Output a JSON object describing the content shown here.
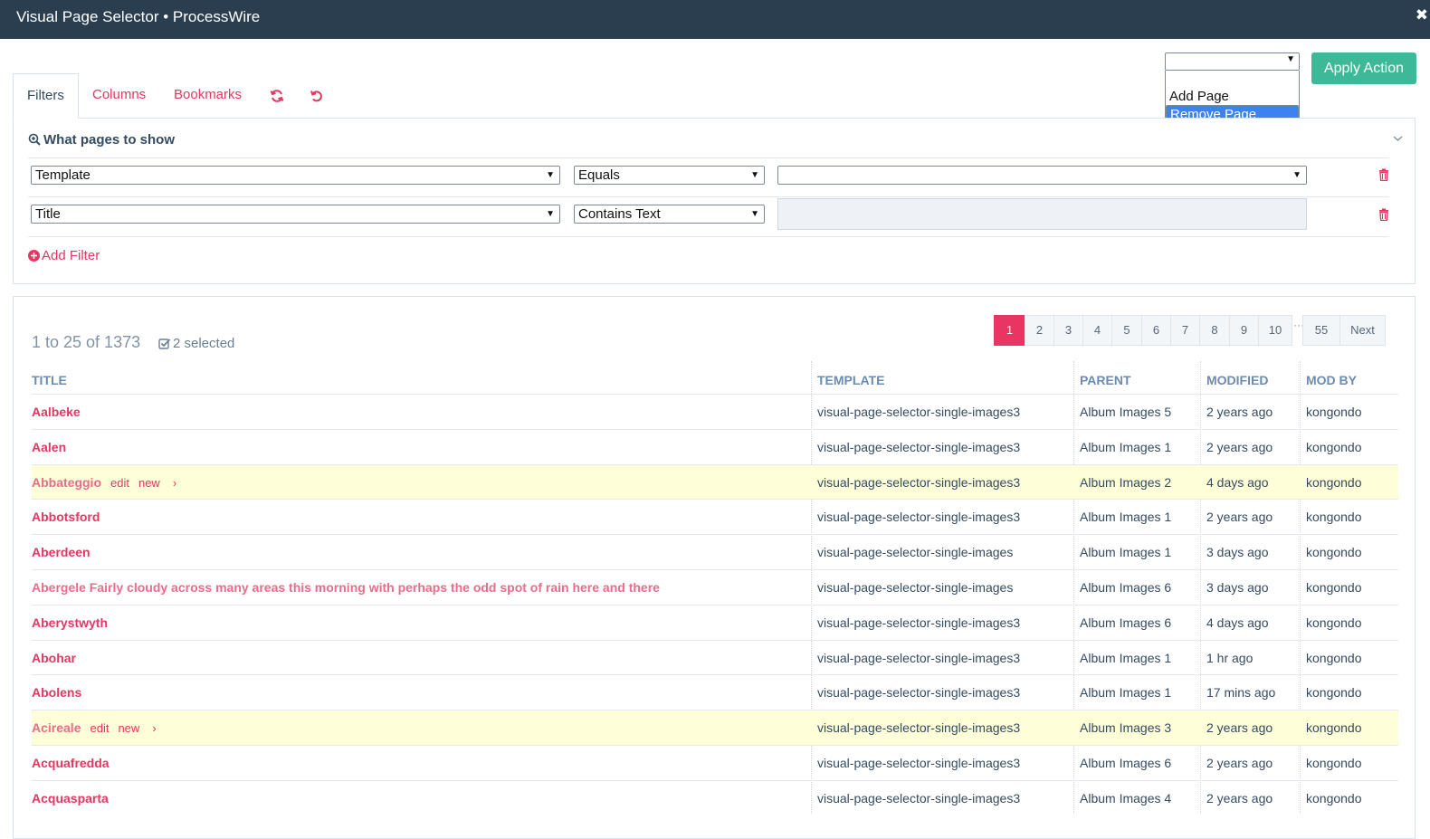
{
  "window": {
    "title": "Visual Page Selector • ProcessWire",
    "close_label": "✖"
  },
  "actions": {
    "select_value": "",
    "options": [
      "Add Page",
      "Remove Page"
    ],
    "selected_option": "Remove Page",
    "apply_label": "Apply Action"
  },
  "tabs": [
    {
      "label": "Filters",
      "active": true
    },
    {
      "label": "Columns",
      "active": false
    },
    {
      "label": "Bookmarks",
      "active": false
    }
  ],
  "tab_icons": [
    "refresh-icon",
    "reset-icon"
  ],
  "filters": {
    "heading": "What pages to show",
    "rows": [
      {
        "field": "Template",
        "operator": "Equals",
        "value": ""
      },
      {
        "field": "Title",
        "operator": "Contains Text",
        "value": ""
      }
    ],
    "add_label": "Add Filter"
  },
  "results": {
    "count": "1 to 25 of 1373",
    "selected": "2 selected",
    "pagination": [
      "1",
      "2",
      "3",
      "4",
      "5",
      "6",
      "7",
      "8",
      "9",
      "10"
    ],
    "pagination_ellipsis": "···",
    "pagination_last": "55",
    "pagination_next": "Next",
    "current_page": "1",
    "columns": [
      "TITLE",
      "TEMPLATE",
      "PARENT",
      "MODIFIED",
      "MOD BY"
    ],
    "row_actions": {
      "edit": "edit",
      "new": "new",
      "more": "›"
    },
    "rows": [
      {
        "title": "Aalbeke",
        "template": "visual-page-selector-single-images3",
        "parent": "Album Images 5",
        "modified": "2 years ago",
        "mod_by": "kongondo",
        "highlight": false
      },
      {
        "title": "Aalen",
        "template": "visual-page-selector-single-images3",
        "parent": "Album Images 1",
        "modified": "2 years ago",
        "mod_by": "kongondo",
        "highlight": false
      },
      {
        "title": "Abbateggio",
        "template": "visual-page-selector-single-images3",
        "parent": "Album Images 2",
        "modified": "4 days ago",
        "mod_by": "kongondo",
        "highlight": true
      },
      {
        "title": "Abbotsford",
        "template": "visual-page-selector-single-images3",
        "parent": "Album Images 1",
        "modified": "2 years ago",
        "mod_by": "kongondo",
        "highlight": false
      },
      {
        "title": "Aberdeen",
        "template": "visual-page-selector-single-images",
        "parent": "Album Images 1",
        "modified": "3 days ago",
        "mod_by": "kongondo",
        "highlight": false
      },
      {
        "title": "Abergele Fairly cloudy across many areas this morning with perhaps the odd spot of rain here and there",
        "template": "visual-page-selector-single-images",
        "parent": "Album Images 6",
        "modified": "3 days ago",
        "mod_by": "kongondo",
        "highlight": false,
        "faded": true
      },
      {
        "title": "Aberystwyth",
        "template": "visual-page-selector-single-images3",
        "parent": "Album Images 6",
        "modified": "4 days ago",
        "mod_by": "kongondo",
        "highlight": false
      },
      {
        "title": "Abohar",
        "template": "visual-page-selector-single-images3",
        "parent": "Album Images 1",
        "modified": "1 hr ago",
        "mod_by": "kongondo",
        "highlight": false
      },
      {
        "title": "Abolens",
        "template": "visual-page-selector-single-images3",
        "parent": "Album Images 1",
        "modified": "17 mins ago",
        "mod_by": "kongondo",
        "highlight": false
      },
      {
        "title": "Acireale",
        "template": "visual-page-selector-single-images3",
        "parent": "Album Images 3",
        "modified": "2 years ago",
        "mod_by": "kongondo",
        "highlight": true
      },
      {
        "title": "Acquafredda",
        "template": "visual-page-selector-single-images3",
        "parent": "Album Images 6",
        "modified": "2 years ago",
        "mod_by": "kongondo",
        "highlight": false
      },
      {
        "title": "Acquasparta",
        "template": "visual-page-selector-single-images3",
        "parent": "Album Images 4",
        "modified": "2 years ago",
        "mod_by": "kongondo",
        "highlight": false
      }
    ]
  }
}
